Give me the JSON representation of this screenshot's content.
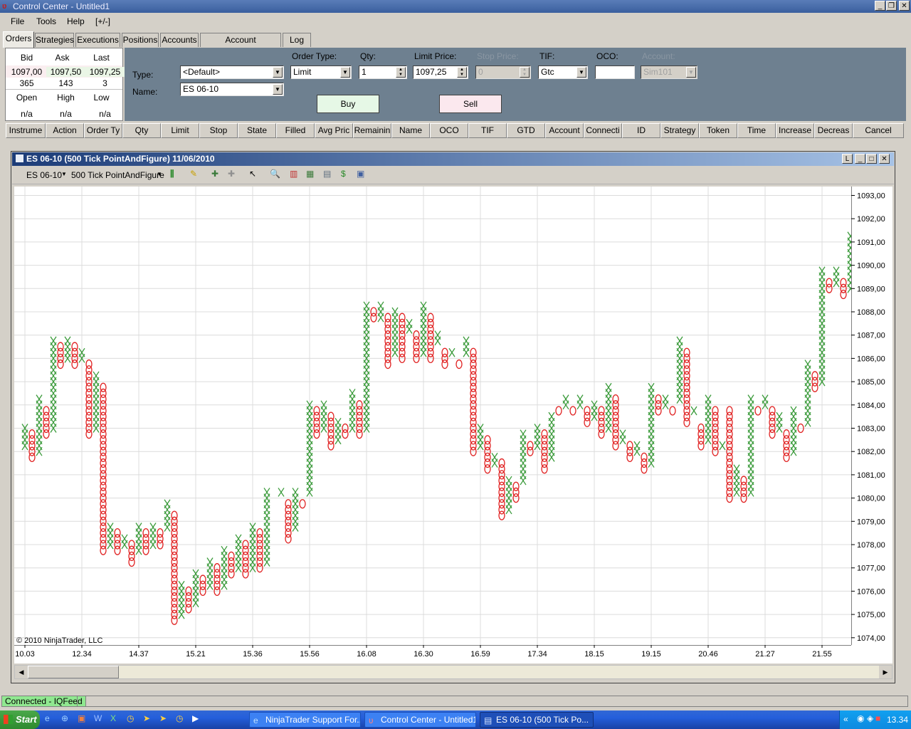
{
  "window": {
    "title": "Control Center - Untitled1"
  },
  "menu": [
    "File",
    "Tools",
    "Help",
    "[+/-]"
  ],
  "tabs": [
    "Orders",
    "Strategies",
    "Executions",
    "Positions",
    "Accounts",
    "Account Performance",
    "Log"
  ],
  "quote": {
    "bid_label": "Bid",
    "ask_label": "Ask",
    "last_label": "Last",
    "bid": "1097,00",
    "ask": "1097,50",
    "last": "1097,25",
    "bid_size": "365",
    "ask_size": "143",
    "last_size": "3",
    "open_label": "Open",
    "high_label": "High",
    "low_label": "Low",
    "open": "n/a",
    "high": "n/a",
    "low": "n/a"
  },
  "order_entry": {
    "type_label": "Type:",
    "type_value": "<Default>",
    "name_label": "Name:",
    "name_value": "ES 06-10",
    "order_type_label": "Order Type:",
    "order_type_value": "Limit",
    "qty_label": "Qty:",
    "qty_value": "1",
    "limit_price_label": "Limit Price:",
    "limit_price_value": "1097,25",
    "stop_price_label": "Stop Price:",
    "stop_price_value": "0",
    "tif_label": "TIF:",
    "tif_value": "Gtc",
    "oco_label": "OCO:",
    "oco_value": "",
    "account_label": "Account:",
    "account_value": "Sim101",
    "buy_label": "Buy",
    "sell_label": "Sell",
    "buy_color": "#e6f8e6",
    "sell_color": "#fbe8ee"
  },
  "columns": [
    "Instrume",
    "Action",
    "Order Ty",
    "Qty",
    "Limit",
    "Stop",
    "State",
    "Filled",
    "Avg Pric",
    "Remainin",
    "Name",
    "OCO",
    "TIF",
    "GTD",
    "Account",
    "Connecti",
    "ID",
    "Strategy",
    "Token",
    "Time",
    "Increase",
    "Decreas",
    "Cancel"
  ],
  "chart_window": {
    "title": "ES 06-10 (500 Tick PointAndFigure)  11/06/2010",
    "instrument": "ES 06-10",
    "period": "500 Tick PointAndFigure",
    "copyright": "© 2010 NinjaTrader, LLC"
  },
  "colors": {
    "x_mark": "#3a9a3a",
    "o_mark": "#e02020",
    "grid": "#dcdcdc"
  },
  "chart_data": {
    "type": "point-and-figure",
    "box_size": 0.25,
    "ylim": [
      1073.75,
      1093.25
    ],
    "y_ticks": [
      "1074,00",
      "1075,00",
      "1076,00",
      "1077,00",
      "1078,00",
      "1079,00",
      "1080,00",
      "1081,00",
      "1082,00",
      "1083,00",
      "1084,00",
      "1085,00",
      "1086,00",
      "1087,00",
      "1088,00",
      "1089,00",
      "1090,00",
      "1091,00",
      "1092,00",
      "1093,00"
    ],
    "x_labels": [
      "10.03",
      "12.34",
      "14.37",
      "15.21",
      "15.36",
      "15.56",
      "16.08",
      "16.30",
      "16.59",
      "17.34",
      "18.15",
      "19.15",
      "20.46",
      "21.27",
      "21.55"
    ],
    "columns": [
      [
        "X",
        1082.25,
        1083.0
      ],
      [
        "O",
        1081.75,
        1082.75
      ],
      [
        "X",
        1082.0,
        1084.25
      ],
      [
        "O",
        1082.75,
        1083.75
      ],
      [
        "X",
        1083.0,
        1086.75
      ],
      [
        "O",
        1085.75,
        1086.5
      ],
      [
        "X",
        1086.0,
        1086.75
      ],
      [
        "O",
        1085.75,
        1086.5
      ],
      [
        "X",
        1086.0,
        1086.25
      ],
      [
        "O",
        1082.75,
        1085.75
      ],
      [
        "X",
        1083.0,
        1085.25
      ],
      [
        "O",
        1077.75,
        1084.75
      ],
      [
        "X",
        1078.0,
        1078.75
      ],
      [
        "O",
        1077.75,
        1078.5
      ],
      [
        "X",
        1078.0,
        1078.25
      ],
      [
        "O",
        1077.25,
        1078.0
      ],
      [
        "X",
        1077.75,
        1078.75
      ],
      [
        "O",
        1077.75,
        1078.5
      ],
      [
        "X",
        1078.0,
        1078.75
      ],
      [
        "O",
        1078.0,
        1078.5
      ],
      [
        "X",
        1078.75,
        1079.75
      ],
      [
        "O",
        1074.75,
        1079.25
      ],
      [
        "X",
        1075.0,
        1076.25
      ],
      [
        "O",
        1075.25,
        1076.0
      ],
      [
        "X",
        1075.5,
        1076.75
      ],
      [
        "O",
        1076.0,
        1076.5
      ],
      [
        "X",
        1076.25,
        1077.25
      ],
      [
        "O",
        1076.0,
        1077.0
      ],
      [
        "X",
        1076.25,
        1077.75
      ],
      [
        "O",
        1076.75,
        1077.5
      ],
      [
        "X",
        1077.0,
        1078.25
      ],
      [
        "O",
        1076.75,
        1078.0
      ],
      [
        "X",
        1077.0,
        1078.75
      ],
      [
        "O",
        1077.0,
        1078.5
      ],
      [
        "X",
        1077.25,
        1080.25
      ],
      [
        "O",
        1080.25,
        1080.0
      ],
      [
        "X",
        1080.25,
        1080.25
      ],
      [
        "O",
        1078.25,
        1079.75
      ],
      [
        "X",
        1078.75,
        1080.25
      ],
      [
        "O",
        1079.75,
        1079.75
      ],
      [
        "X",
        1080.25,
        1084.0
      ],
      [
        "O",
        1082.75,
        1083.75
      ],
      [
        "X",
        1083.0,
        1084.0
      ],
      [
        "O",
        1082.25,
        1083.5
      ],
      [
        "X",
        1082.5,
        1083.25
      ],
      [
        "O",
        1082.75,
        1083.0
      ],
      [
        "X",
        1083.0,
        1084.5
      ],
      [
        "O",
        1082.75,
        1084.0
      ],
      [
        "X",
        1083.0,
        1088.25
      ],
      [
        "O",
        1087.75,
        1088.0
      ],
      [
        "X",
        1087.75,
        1088.25
      ],
      [
        "O",
        1085.75,
        1087.75
      ],
      [
        "X",
        1086.25,
        1088.0
      ],
      [
        "O",
        1086.0,
        1087.75
      ],
      [
        "X",
        1087.25,
        1087.5
      ],
      [
        "O",
        1086.0,
        1087.0
      ],
      [
        "X",
        1086.25,
        1088.25
      ],
      [
        "O",
        1086.0,
        1087.75
      ],
      [
        "X",
        1086.75,
        1087.0
      ],
      [
        "O",
        1085.75,
        1086.25
      ],
      [
        "X",
        1086.25,
        1086.25
      ],
      [
        "O",
        1085.75,
        1085.75
      ],
      [
        "X",
        1086.25,
        1086.75
      ],
      [
        "O",
        1082.0,
        1086.25
      ],
      [
        "X",
        1082.25,
        1083.0
      ],
      [
        "O",
        1081.25,
        1082.5
      ],
      [
        "X",
        1081.5,
        1081.75
      ],
      [
        "O",
        1079.25,
        1081.5
      ],
      [
        "X",
        1079.5,
        1080.75
      ],
      [
        "O",
        1080.0,
        1080.5
      ],
      [
        "X",
        1080.75,
        1082.75
      ],
      [
        "O",
        1082.0,
        1082.25
      ],
      [
        "X",
        1082.25,
        1083.0
      ],
      [
        "O",
        1081.25,
        1082.75
      ],
      [
        "X",
        1081.75,
        1083.5
      ],
      [
        "O",
        1083.75,
        1083.75
      ],
      [
        "X",
        1084.0,
        1084.25
      ],
      [
        "O",
        1083.75,
        1083.75
      ],
      [
        "X",
        1084.0,
        1084.25
      ],
      [
        "O",
        1083.25,
        1083.75
      ],
      [
        "X",
        1083.5,
        1084.0
      ],
      [
        "O",
        1082.75,
        1083.75
      ],
      [
        "X",
        1083.0,
        1084.75
      ],
      [
        "O",
        1082.25,
        1084.25
      ],
      [
        "X",
        1082.5,
        1082.75
      ],
      [
        "O",
        1081.75,
        1082.25
      ],
      [
        "X",
        1082.0,
        1082.25
      ],
      [
        "O",
        1081.25,
        1081.75
      ],
      [
        "X",
        1081.5,
        1084.75
      ],
      [
        "O",
        1083.75,
        1084.25
      ],
      [
        "X",
        1084.0,
        1084.25
      ],
      [
        "O",
        1083.75,
        1083.75
      ],
      [
        "X",
        1084.25,
        1086.75
      ],
      [
        "O",
        1083.25,
        1086.25
      ],
      [
        "X",
        1083.75,
        1083.75
      ],
      [
        "O",
        1082.25,
        1083.0
      ],
      [
        "X",
        1082.5,
        1084.25
      ],
      [
        "O",
        1082.0,
        1083.75
      ],
      [
        "X",
        1082.25,
        1082.25
      ],
      [
        "O",
        1080.0,
        1083.75
      ],
      [
        "X",
        1080.25,
        1081.25
      ],
      [
        "O",
        1080.0,
        1080.75
      ],
      [
        "X",
        1080.25,
        1084.25
      ],
      [
        "O",
        1083.75,
        1083.75
      ],
      [
        "X",
        1084.0,
        1084.25
      ],
      [
        "O",
        1082.75,
        1083.75
      ],
      [
        "X",
        1083.0,
        1083.5
      ],
      [
        "O",
        1081.75,
        1082.75
      ],
      [
        "X",
        1082.0,
        1083.75
      ],
      [
        "O",
        1083.0,
        1083.0
      ],
      [
        "X",
        1083.25,
        1085.75
      ],
      [
        "O",
        1084.75,
        1085.25
      ],
      [
        "X",
        1085.0,
        1089.75
      ],
      [
        "O",
        1089.0,
        1089.25
      ],
      [
        "X",
        1089.25,
        1089.75
      ],
      [
        "O",
        1088.75,
        1089.25
      ],
      [
        "X",
        1089.0,
        1091.25
      ],
      [
        "O",
        1089.75,
        1090.75
      ],
      [
        "X",
        1090.0,
        1092.25
      ],
      [
        "O",
        1090.75,
        1091.75
      ],
      [
        "X",
        1091.0,
        1091.75
      ],
      [
        "O",
        1089.75,
        1091.25
      ]
    ]
  },
  "status": {
    "connection": "Connected - IQFeed"
  },
  "taskbar": {
    "start_label": "Start",
    "tasks": [
      "NinjaTrader Support For...",
      "Control Center - Untitled1",
      "ES 06-10 (500 Tick Po..."
    ],
    "clock": "13.34"
  }
}
